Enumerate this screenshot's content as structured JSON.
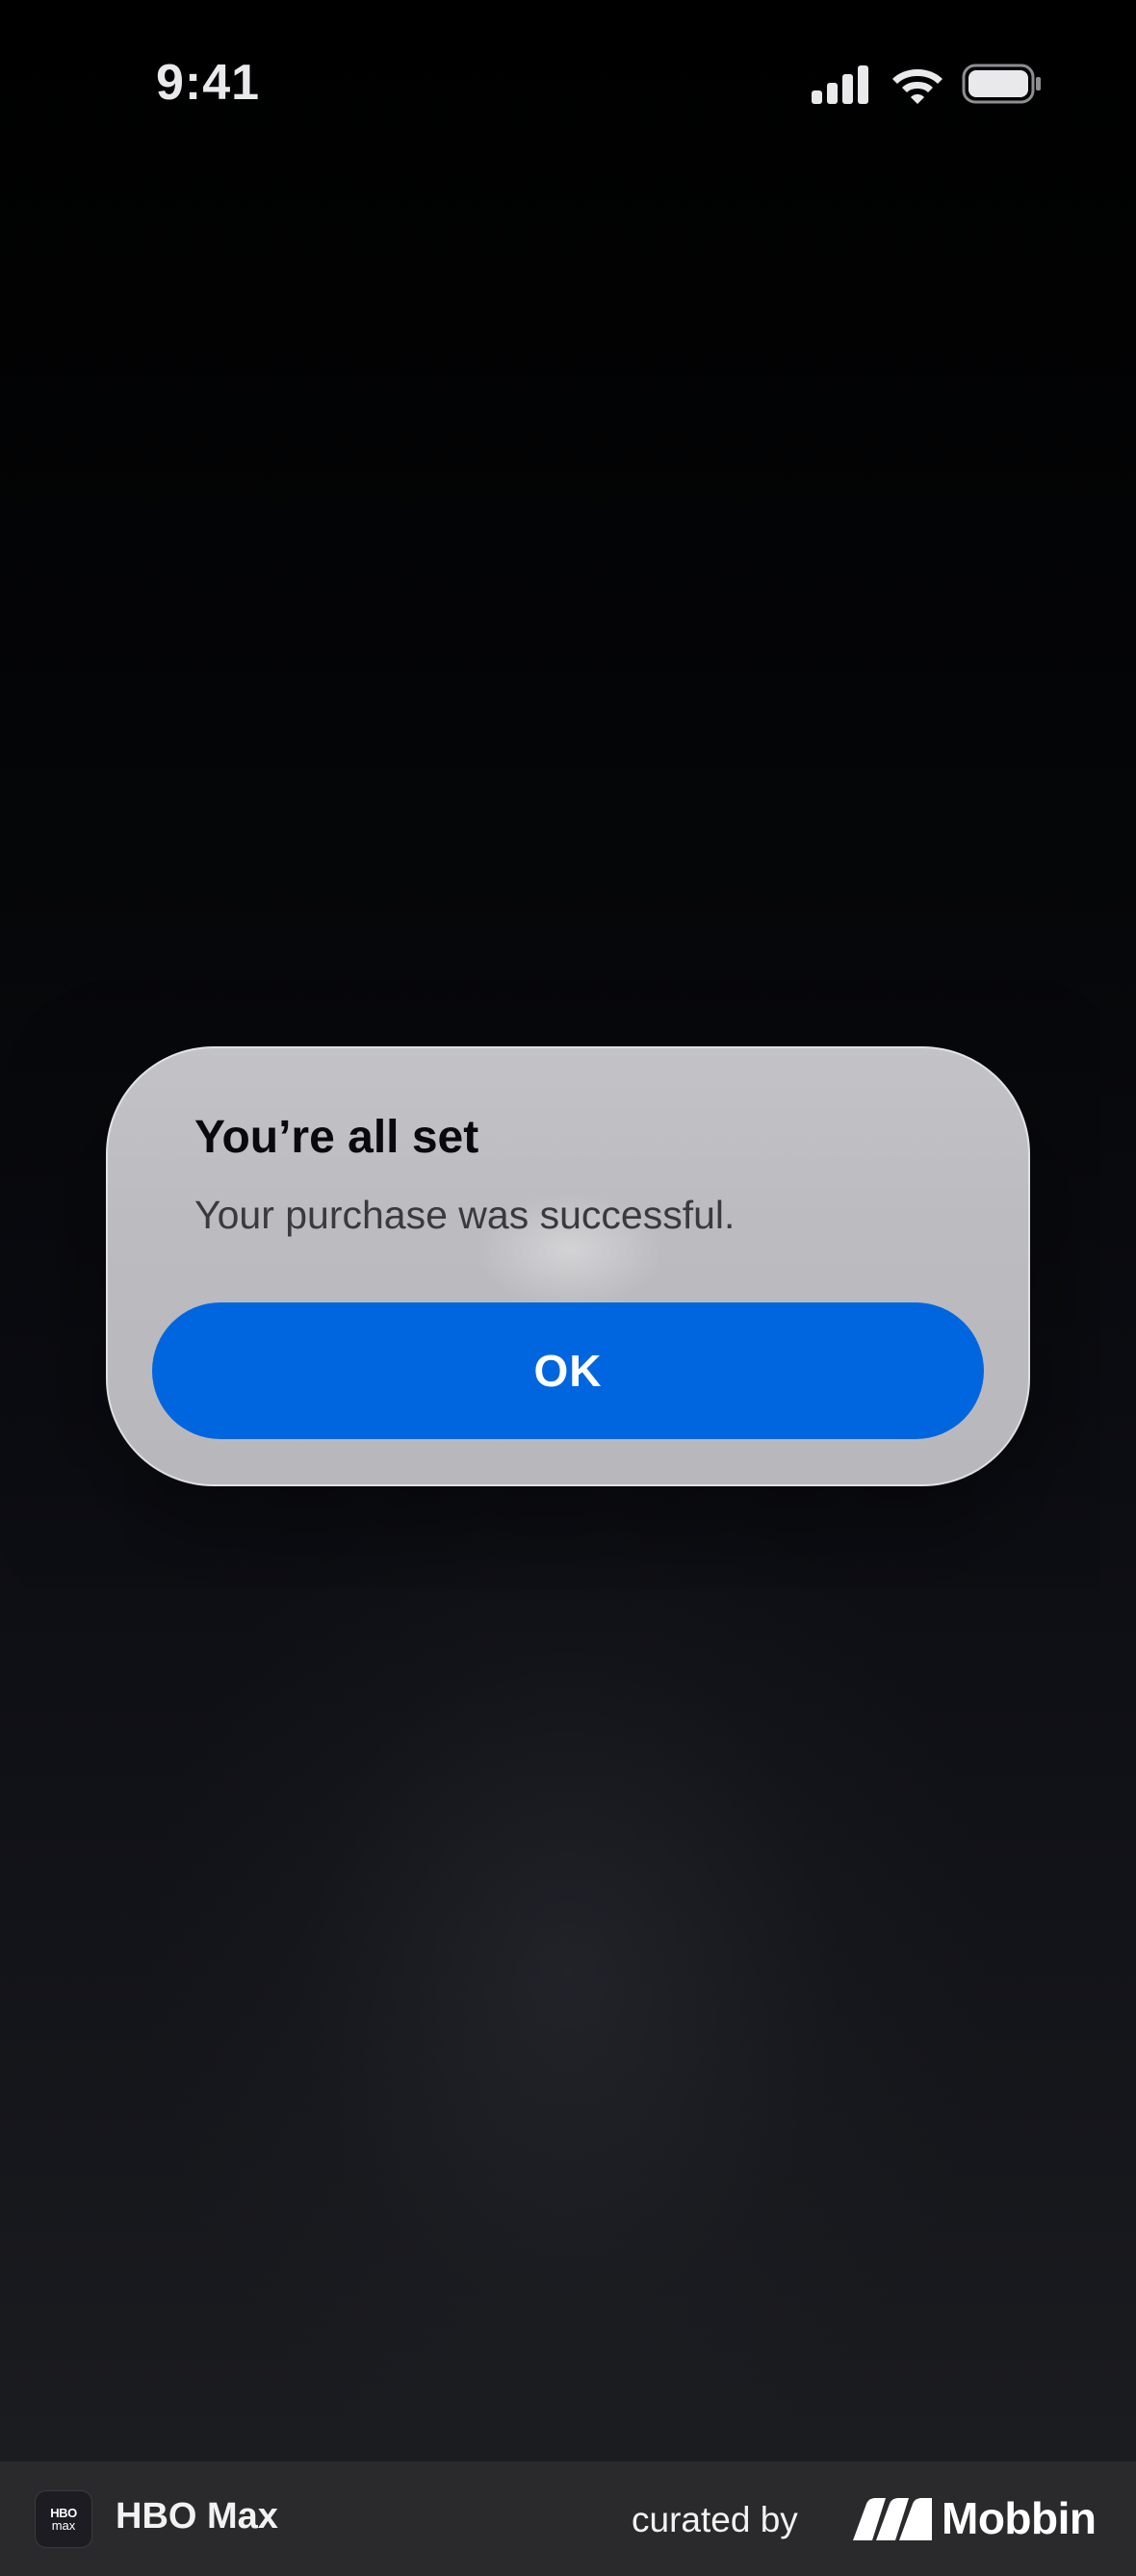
{
  "status_bar": {
    "time": "9:41",
    "icons": [
      "cellular-signal-icon",
      "wifi-icon",
      "battery-icon"
    ]
  },
  "alert": {
    "title": "You’re all set",
    "message": "Your purchase was successful.",
    "ok_label": "OK",
    "button_color": "#0066e0"
  },
  "attribution": {
    "app_icon_line1": "HBO",
    "app_icon_line2": "max",
    "app_name": "HBO Max",
    "curated_by": "curated by",
    "brand": "Mobbin"
  },
  "colors": {
    "background": "#000000",
    "alert_background": "#bdbdc1",
    "accent": "#0066e0",
    "attribution_bar": "#2a2a2c"
  }
}
